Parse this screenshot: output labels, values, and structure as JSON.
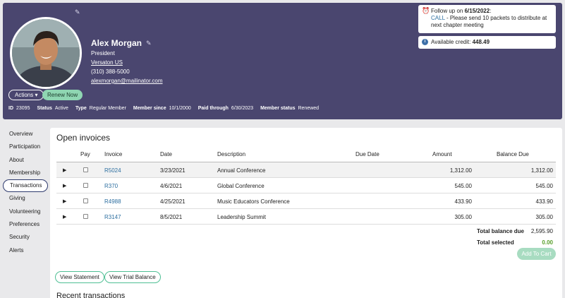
{
  "profile": {
    "name": "Alex Morgan",
    "title": "President",
    "organization": "Versaton US",
    "phone": "(310) 388-5000",
    "email": "alexmorgan@mailinator.com",
    "actions_label": "Actions",
    "renew_label": "Renew Now"
  },
  "meta": [
    {
      "label": "ID",
      "value": "23095"
    },
    {
      "label": "Status",
      "value": "Active"
    },
    {
      "label": "Type",
      "value": "Regular Member"
    },
    {
      "label": "Member since",
      "value": "10/1/2000"
    },
    {
      "label": "Paid through",
      "value": "6/30/2023"
    },
    {
      "label": "Member status",
      "value": "Renewed"
    }
  ],
  "followup": {
    "prefix": "Follow up on ",
    "date": "6/15/2022",
    "suffix": ":",
    "call": "CALL",
    "text": " - Please send 10 packets to distribute at next chapter meeting"
  },
  "credit": {
    "label": "Available credit: ",
    "value": "448.49"
  },
  "sidebar": {
    "items": [
      {
        "label": "Overview",
        "id": "overview"
      },
      {
        "label": "Participation",
        "id": "participation"
      },
      {
        "label": "About",
        "id": "about"
      },
      {
        "label": "Membership",
        "id": "membership"
      },
      {
        "label": "Transactions",
        "id": "transactions"
      },
      {
        "label": "Giving",
        "id": "giving"
      },
      {
        "label": "Volunteering",
        "id": "volunteering"
      },
      {
        "label": "Preferences",
        "id": "preferences"
      },
      {
        "label": "Security",
        "id": "security"
      },
      {
        "label": "Alerts",
        "id": "alerts"
      }
    ],
    "active": "Transactions"
  },
  "invoices": {
    "title": "Open invoices",
    "columns": {
      "pay": "Pay",
      "invoice": "Invoice",
      "date": "Date",
      "description": "Description",
      "due_date": "Due Date",
      "amount": "Amount",
      "balance_due": "Balance Due"
    },
    "rows": [
      {
        "invoice": "R5024",
        "date": "3/23/2021",
        "description": "Annual Conference",
        "due_date": "",
        "amount": "1,312.00",
        "balance": "1,312.00"
      },
      {
        "invoice": "R370",
        "date": "4/6/2021",
        "description": "Global Conference",
        "due_date": "",
        "amount": "545.00",
        "balance": "545.00"
      },
      {
        "invoice": "R4988",
        "date": "4/25/2021",
        "description": "Music Educators Conference",
        "due_date": "",
        "amount": "433.90",
        "balance": "433.90"
      },
      {
        "invoice": "R3147",
        "date": "8/5/2021",
        "description": "Leadership Summit",
        "due_date": "",
        "amount": "305.00",
        "balance": "305.00"
      }
    ],
    "total_balance_label": "Total balance due",
    "total_balance_value": "2,595.90",
    "total_selected_label": "Total selected",
    "total_selected_value": "0.00",
    "add_to_cart": "Add To Cart",
    "view_statement": "View Statement",
    "view_trial_balance": "View Trial Balance"
  },
  "recent_title": "Recent transactions",
  "colors": {
    "header_bg": "#4a466f",
    "link": "#2d6fa0",
    "accent_green": "#8fd6b2",
    "selected_total": "#5aa02c"
  }
}
